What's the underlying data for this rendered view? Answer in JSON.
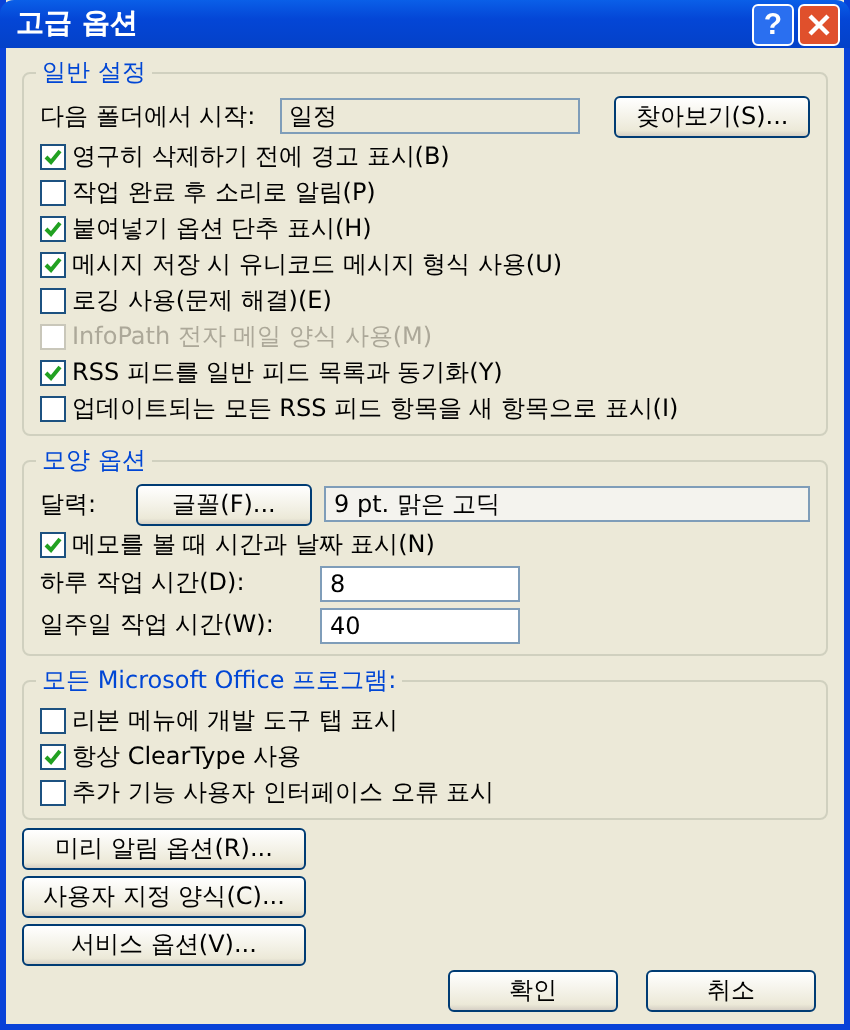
{
  "window": {
    "title": "고급 옵션",
    "help_button": "?"
  },
  "general": {
    "title": "일반 설정",
    "start_folder": {
      "label": "다음 폴더에서 시작:",
      "value": "일정"
    },
    "browse_button": "찾아보기(S)...",
    "options": [
      {
        "label": "영구히 삭제하기 전에 경고 표시(B)",
        "checked": true,
        "disabled": false
      },
      {
        "label": "작업 완료 후 소리로 알림(P)",
        "checked": false,
        "disabled": false
      },
      {
        "label": "붙여넣기 옵션 단추 표시(H)",
        "checked": true,
        "disabled": false
      },
      {
        "label": "메시지 저장 시 유니코드 메시지 형식 사용(U)",
        "checked": true,
        "disabled": false
      },
      {
        "label": "로깅 사용(문제 해결)(E)",
        "checked": false,
        "disabled": false
      },
      {
        "label": "InfoPath 전자 메일 양식 사용(M)",
        "checked": false,
        "disabled": true
      },
      {
        "label": "RSS 피드를 일반 피드 목록과 동기화(Y)",
        "checked": true,
        "disabled": false
      },
      {
        "label": "업데이트되는 모든 RSS 피드 항목을 새 항목으로 표시(I)",
        "checked": false,
        "disabled": false
      }
    ]
  },
  "appearance": {
    "title": "모양 옵션",
    "calendar": {
      "label": "달력:",
      "font_button": "글꼴(F)...",
      "font_value": "9 pt. 맑은 고딕"
    },
    "options": [
      {
        "label": "메모를 볼 때 시간과 날짜 표시(N)",
        "checked": true,
        "disabled": false
      }
    ],
    "fields": [
      {
        "label": "하루 작업 시간(D):",
        "value": "8"
      },
      {
        "label": "일주일 작업 시간(W):",
        "value": "40"
      }
    ]
  },
  "office": {
    "title": "모든 Microsoft Office 프로그램:",
    "options": [
      {
        "label": "리본 메뉴에 개발 도구 탭 표시",
        "checked": false,
        "disabled": false
      },
      {
        "label": "항상 ClearType 사용",
        "checked": true,
        "disabled": false
      },
      {
        "label": "추가 기능 사용자 인터페이스 오류 표시",
        "checked": false,
        "disabled": false
      }
    ]
  },
  "side_buttons": [
    "미리 알림 옵션(R)...",
    "사용자 지정 양식(C)...",
    "서비스 옵션(V)..."
  ],
  "footer_buttons": [
    "확인",
    "취소"
  ]
}
